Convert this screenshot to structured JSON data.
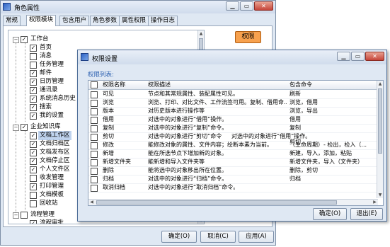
{
  "main_window": {
    "title": "角色属性",
    "icon": "app-icon",
    "controls": [
      "minimize",
      "maximize",
      "close"
    ],
    "tabs": [
      {
        "label": "常规"
      },
      {
        "label": "权限模块",
        "active": true
      },
      {
        "label": "包含用户"
      },
      {
        "label": "角色参数"
      },
      {
        "label": "属性权限"
      },
      {
        "label": "操作日志"
      }
    ],
    "permission_button": "权限",
    "tree": [
      {
        "label": "工作台",
        "checked": true
      },
      {
        "label": "首页",
        "checked": true
      },
      {
        "label": "消息",
        "checked": false
      },
      {
        "label": "任务管理",
        "checked": false
      },
      {
        "label": "邮件",
        "checked": true
      },
      {
        "label": "日历管理",
        "checked": true
      },
      {
        "label": "通讯录",
        "checked": true
      },
      {
        "label": "系统消息历史",
        "checked": true
      },
      {
        "label": "搜索",
        "checked": true
      },
      {
        "label": "我的设置",
        "checked": true
      },
      {
        "label": "企业知识库",
        "checked": true
      },
      {
        "label": "文档工作区",
        "checked": true,
        "selected": true
      },
      {
        "label": "文档归档区",
        "checked": true
      },
      {
        "label": "文档发布区",
        "checked": true
      },
      {
        "label": "文档停止区",
        "checked": true
      },
      {
        "label": "个人文件区",
        "checked": true
      },
      {
        "label": "收发管理",
        "checked": false
      },
      {
        "label": "打印管理",
        "checked": true
      },
      {
        "label": "文档模板",
        "checked": false
      },
      {
        "label": "回收站",
        "checked": false
      },
      {
        "label": "流程管理",
        "checked": false
      },
      {
        "label": "流程审批",
        "checked": true
      }
    ],
    "buttons": {
      "ok": "确定(O)",
      "cancel": "取消(C)",
      "apply": "应用(A)"
    }
  },
  "dialog": {
    "title": "权限设置",
    "list_caption": "权限列表:",
    "columns": [
      "",
      "权限名称",
      "权限描述",
      "包含命令"
    ],
    "rows": [
      {
        "checked": false,
        "name": "可见",
        "desc": "节点和其常规属性、装配属性可见。",
        "cmd": "刷新"
      },
      {
        "checked": false,
        "name": "浏览",
        "desc": "浏览、打印、对比文件、工作流签可用。复制、借用命...",
        "cmd": "浏览，借用"
      },
      {
        "checked": false,
        "name": "版本",
        "desc": "对历史版本进行操作等",
        "cmd": "浏览，导出"
      },
      {
        "checked": false,
        "name": "借用",
        "desc": "对选中的对象进行“借用”操作。",
        "cmd": "借用"
      },
      {
        "checked": false,
        "name": "复制",
        "desc": "对选中的对象进行“复制”命令。",
        "cmd": "复制"
      },
      {
        "checked": false,
        "name": "剪切",
        "desc": "对选中的对象进行“剪切”命令",
        "cmd": "剪切",
        "extra": "对选中的对象进行“借用”操作。"
      },
      {
        "checked": false,
        "name": "修改",
        "desc": "能修改对象的属性、文件内容；绘断本素为当前。",
        "cmd": "（生命周期）- 检出，检入（..."
      },
      {
        "checked": false,
        "name": "新增",
        "desc": "能在所选节点下增加新的对象。",
        "cmd": "新建，导入，添加，粘贴"
      },
      {
        "checked": false,
        "name": "新增文件夹",
        "desc": "能新增和导入文件夹等",
        "cmd": "新增文件夹，导入（文件夹）"
      },
      {
        "checked": false,
        "name": "删除",
        "desc": "能将选中的对象移出所在位置。",
        "cmd": "删除，剪切"
      },
      {
        "checked": false,
        "name": "归档",
        "desc": "对选中的对象进行“归档”命令。",
        "cmd": "归档"
      },
      {
        "checked": false,
        "name": "取消归档",
        "desc": "对选中的对象进行“取消归档”命令。",
        "cmd": ""
      }
    ],
    "buttons": {
      "ok": "确定(O)",
      "exit": "退出(E)"
    }
  }
}
